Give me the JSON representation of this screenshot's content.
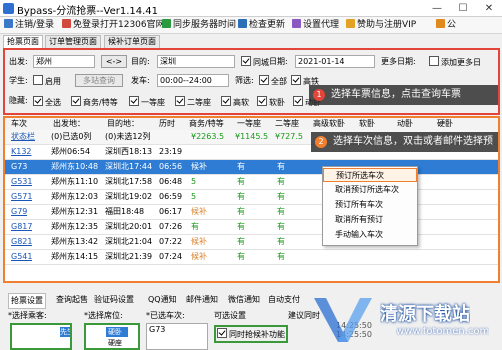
{
  "window": {
    "title": "Bypass-分流抢票--Ver1.14.41",
    "minimize": "—",
    "maximize": "☐",
    "close": "✕"
  },
  "toolbar": {
    "login": "注销/登录",
    "free_open": "免登录打开12306官网",
    "sync": "同步服务器时间",
    "update": "检查更新",
    "proxy": "设置代理",
    "vip": "赞助与注册VIP",
    "notice": "公"
  },
  "tabs": [
    "抢票页面",
    "订单管理页面",
    "候补订单页面"
  ],
  "query": {
    "from_label": "出发:",
    "from_value": "郑州",
    "swap": "<->",
    "to_label": "目的:",
    "to_value": "深圳",
    "same_city": "同城",
    "date_label": "日期:",
    "date_value": "2021-01-14",
    "more_dates": "更多日期:",
    "add_more": "添加更多日",
    "student_label": "学生:",
    "student": "启用",
    "multi_station": "多站查询",
    "depart_label": "发车:",
    "depart_value": "00:00--24:00",
    "filter_label": "筛选:",
    "filter_all": "全部",
    "filter_gaotie": "高铁",
    "hide_label": "隐藏:",
    "hide_items": [
      "全选",
      "商务/特等",
      "一等座",
      "二等座",
      "高软",
      "软卧",
      "动卧"
    ]
  },
  "tips": {
    "one_num": "1",
    "one": "选择车票信息，点击查询车票",
    "two_num": "2",
    "two": "选择车次信息，双击或者邮件选择预"
  },
  "grid": {
    "headers": [
      "车次",
      "出发地：",
      "目的地：",
      "历时",
      "商务/特等",
      "一等座",
      "二等座",
      "高级软卧",
      "软卧",
      "动卧",
      "硬卧"
    ],
    "summary": [
      "状态栏",
      "(0)已选0列",
      "(0)未选12列",
      "",
      "¥2263.5",
      "¥1145.5",
      "¥727.5"
    ],
    "rows": [
      {
        "train": "K132",
        "dep": "郑州06:54",
        "arr": "深圳西18:13",
        "dur": "23:19",
        "biz": "",
        "first": "",
        "second": "",
        "seat": "",
        "soft": "",
        "dsoft": ""
      },
      {
        "train": "G73",
        "dep": "郑州东10:48",
        "arr": "深圳北17:44",
        "dur": "06:56",
        "biz": "候补",
        "first": "有",
        "second": "有",
        "seat": "",
        "soft": "",
        "dsoft": ""
      },
      {
        "train": "G531",
        "dep": "郑州东11:10",
        "arr": "深圳北17:58",
        "dur": "06:48",
        "biz": "5",
        "first": "有",
        "second": "有",
        "seat": "",
        "soft": "",
        "dsoft": ""
      },
      {
        "train": "G571",
        "dep": "郑州东12:03",
        "arr": "深圳北19:02",
        "dur": "06:59",
        "biz": "5",
        "first": "有",
        "second": "有",
        "seat": "",
        "soft": "",
        "dsoft": ""
      },
      {
        "train": "G79",
        "dep": "郑州东12:31",
        "arr": "福田18:48",
        "dur": "06:17",
        "biz": "候补",
        "first": "有",
        "second": "有",
        "seat": "",
        "soft": "",
        "dsoft": ""
      },
      {
        "train": "G817",
        "dep": "郑州东12:35",
        "arr": "深圳北20:01",
        "dur": "07:26",
        "biz": "有",
        "first": "有",
        "second": "有",
        "seat": "",
        "soft": "",
        "dsoft": ""
      },
      {
        "train": "G821",
        "dep": "郑州东13:42",
        "arr": "深圳北21:04",
        "dur": "07:22",
        "biz": "候补",
        "first": "有",
        "second": "有",
        "seat": "",
        "soft": "",
        "dsoft": ""
      },
      {
        "train": "G541",
        "dep": "郑州东14:15",
        "arr": "深圳北21:39",
        "dur": "07:24",
        "biz": "候补",
        "first": "有",
        "second": "有",
        "seat": "",
        "soft": "",
        "dsoft": ""
      }
    ]
  },
  "context_menu": [
    "预订所选车次",
    "取消预订所选车次",
    "预订所有车次",
    "取消所有预订",
    "手动输入车次"
  ],
  "bottom": {
    "tabs": [
      "抢票设置",
      "查询起售",
      "验证码设置",
      "QQ通知",
      "邮件通知",
      "微信通知",
      "自动支付"
    ],
    "sel_passenger": "*选择乘客:",
    "sel_seat": "*选择席位:",
    "sel_train": "*已选车次:",
    "p1": "先生)",
    "s1": "硬卧",
    "s2": "硬座",
    "train_value": "G73",
    "optional": "可选设置",
    "cb_waitlist": "同时抢候补功能",
    "advice": "建议同时",
    "times": [
      "14:25:50",
      "14:25:50",
      "14:25:50",
      "14:25:50"
    ]
  },
  "watermark": {
    "title": "清源下载站",
    "url": "www.fotomen.com"
  },
  "colors": {
    "red_border": "#e4453a",
    "orange_border": "#f08030",
    "selected_row": "#2f7cd4",
    "green_border": "#3a9a3a"
  }
}
